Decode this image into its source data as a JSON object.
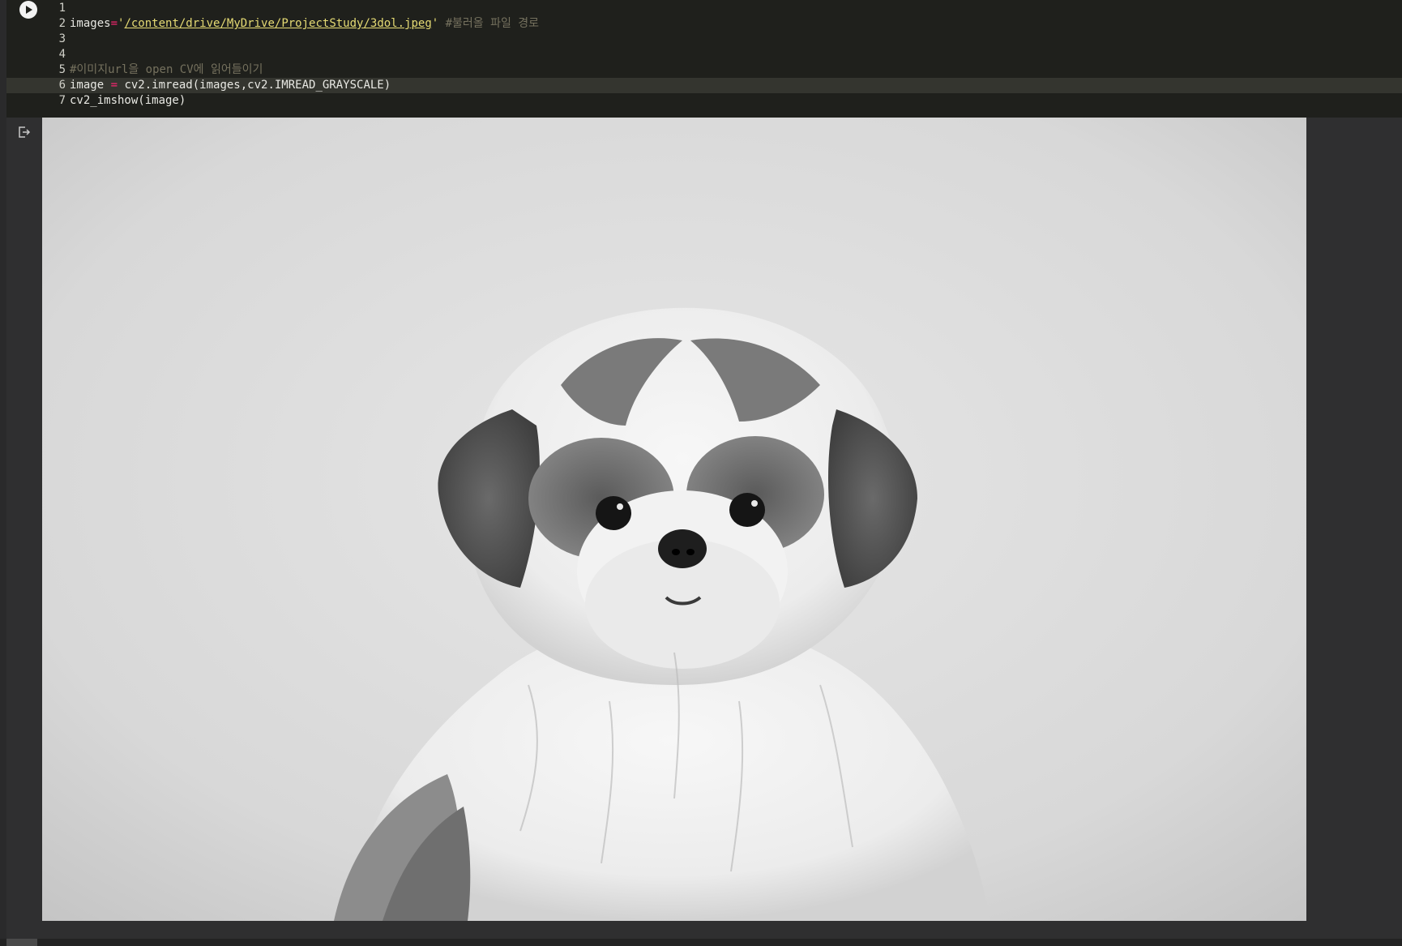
{
  "cell": {
    "run_button_icon": "play-icon",
    "lines": [
      {
        "num": "1",
        "parts": []
      },
      {
        "num": "2",
        "parts": [
          {
            "t": "images",
            "c": "plain"
          },
          {
            "t": "=",
            "c": "op"
          },
          {
            "t": "'",
            "c": "str"
          },
          {
            "t": "/content/drive/MyDrive/ProjectStudy/3dol.jpeg",
            "c": "path"
          },
          {
            "t": "'",
            "c": "str"
          },
          {
            "t": " #불러올 파일 경로",
            "c": "comment"
          }
        ]
      },
      {
        "num": "3",
        "parts": []
      },
      {
        "num": "4",
        "parts": []
      },
      {
        "num": "5",
        "parts": [
          {
            "t": "#이미지url을 open CV에 읽어들이기",
            "c": "comment"
          }
        ]
      },
      {
        "num": "6",
        "active": true,
        "parts": [
          {
            "t": "image ",
            "c": "plain"
          },
          {
            "t": "=",
            "c": "op"
          },
          {
            "t": " cv2.imread(images,cv2.IMREAD_GRAYSCALE)",
            "c": "plain"
          }
        ]
      },
      {
        "num": "7",
        "parts": [
          {
            "t": "cv2_imshow(image)",
            "c": "plain"
          }
        ]
      }
    ]
  },
  "output": {
    "icon": "output-redirect-icon",
    "image_subject": "grayscale-dog-photo"
  },
  "colors": {
    "editor_bg": "#1f201c",
    "output_bg": "#2f2f30",
    "keyword_op": "#f92672",
    "string": "#e6db74",
    "comment": "#75715e"
  }
}
